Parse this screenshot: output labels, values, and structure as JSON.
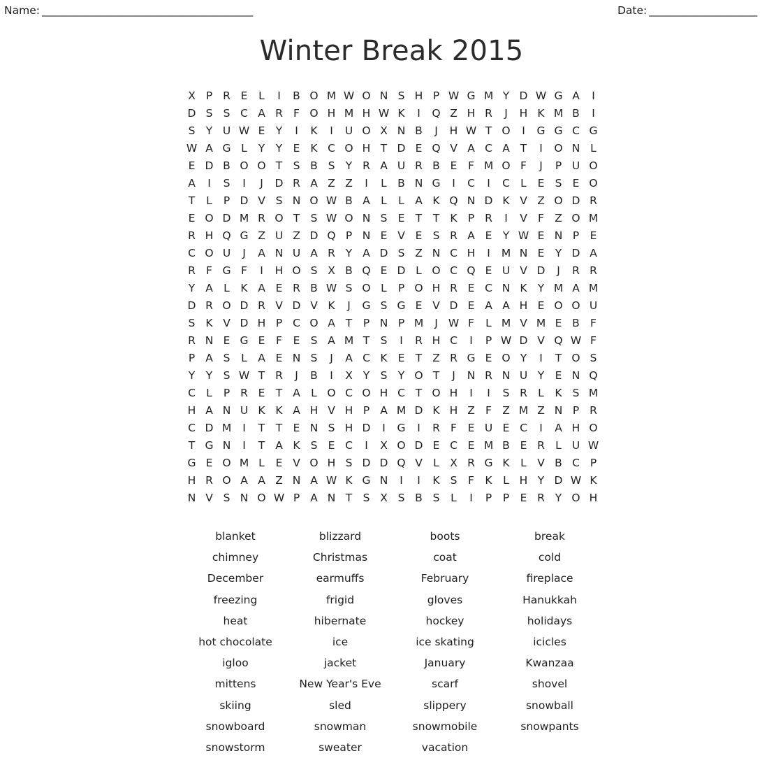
{
  "header": {
    "name_label": "Name:",
    "name_rule": "_______________________________________",
    "date_label": "Date:",
    "date_rule": "____________________"
  },
  "title": "Winter Break 2015",
  "grid": {
    "columns": 24,
    "rows": [
      "X P R E L I B O M W O N S H P W G M Y D W G A I",
      "D S S C A R F O H M H W K I Q Z H R J H K M B I",
      "S Y U W E Y I K I U O X N B J H W T O I G G C G",
      "W A G L Y Y E K C O H T D E Q V A C A T I O N L",
      "E D B O O T S B S Y R A U R B E F M O F J P U O",
      "A I S I J D R A Z Z I L B N G I C I C L E S E O",
      "T L P D V S N O W B A L L A K Q N D K V Z O D R",
      "E O D M R O T S W O N S E T T K P R I V F Z O M",
      "R H Q G Z U Z D Q P N E V E S R A E Y W E N P E",
      "C O U J A N U A R Y A D S Z N C H I M N E Y D A",
      "R F G F I H O S X B Q E D L O C Q E U V D J R R",
      "Y A L K A E R B W S O L P O H R E C N K Y M A M",
      "D R O D R V D V K J G S G E V D E A A H E O O U",
      "S K V D H P C O A T P N P M J W F L M V M E B F",
      "R N E G E F E S A M T S I R H C I P W D V Q W F",
      "P A S L A E N S J A C K E T Z R G E O Y I T O S",
      "Y Y S W T R J B I X Y S Y O T J N R N U Y E N Q",
      "C L P R E T A L O C O H C T O H I I S R L K S M",
      "H A N U K K A H V H P A M D K H Z F Z M Z N P R",
      "C D M I T T E N S H D I G I R F E U E C I A H O",
      "T G N I T A K S E C I X O D E C E M B E R L U W",
      "G E O M L E V O H S D D Q V L X R G K L V B C P",
      "H R O A A Z N A W K G N I I K S F K L H Y D W K",
      "N V S N O W P A N T S X S B S L I P P E R Y O H"
    ]
  },
  "word_list": {
    "columns": 4,
    "rows": [
      [
        "blanket",
        "blizzard",
        "boots",
        "break"
      ],
      [
        "chimney",
        "Christmas",
        "coat",
        "cold"
      ],
      [
        "December",
        "earmuffs",
        "February",
        "fireplace"
      ],
      [
        "freezing",
        "frigid",
        "gloves",
        "Hanukkah"
      ],
      [
        "heat",
        "hibernate",
        "hockey",
        "holidays"
      ],
      [
        "hot chocolate",
        "ice",
        "ice skating",
        "icicles"
      ],
      [
        "igloo",
        "jacket",
        "January",
        "Kwanzaa"
      ],
      [
        "mittens",
        "New Year's Eve",
        "scarf",
        "shovel"
      ],
      [
        "skiing",
        "sled",
        "slippery",
        "snowball"
      ],
      [
        "snowboard",
        "snowman",
        "snowmobile",
        "snowpants"
      ],
      [
        "snowstorm",
        "sweater",
        "vacation",
        ""
      ]
    ]
  }
}
